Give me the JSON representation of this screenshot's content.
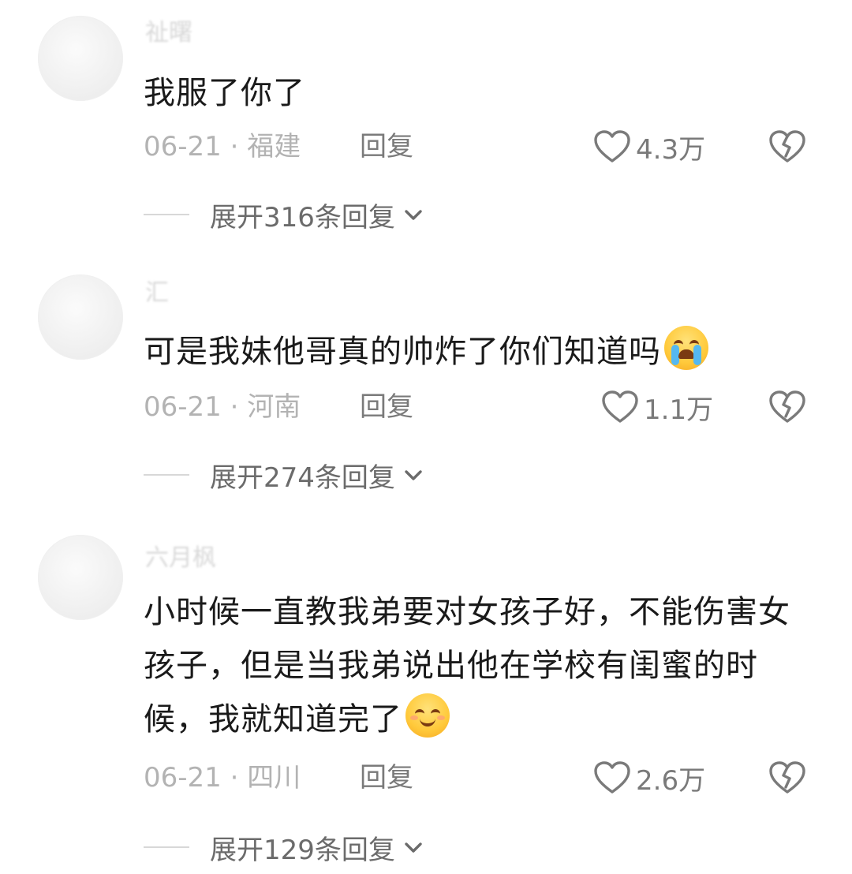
{
  "comments": [
    {
      "username": "祉曙",
      "text": "我服了你了",
      "emoji": "",
      "date": "06-21",
      "separator": "·",
      "location": "福建",
      "reply_label": "回复",
      "likes": "4.3万",
      "expand_label": "展开316条回复"
    },
    {
      "username": "汇",
      "text": "可是我妹他哥真的帅炸了你们知道吗",
      "emoji": "loudly-crying-face",
      "date": "06-21",
      "separator": "·",
      "location": "河南",
      "reply_label": "回复",
      "likes": "1.1万",
      "expand_label": "展开274条回复"
    },
    {
      "username": "六月枫",
      "text": "小时候一直教我弟要对女孩子好，不能伤害女孩子，但是当我弟说出他在学校有闺蜜的时候，我就知道完了",
      "emoji": "smiling-face-with-smiling-eyes",
      "date": "06-21",
      "separator": "·",
      "location": "四川",
      "reply_label": "回复",
      "likes": "2.6万",
      "expand_label": "展开129条回复"
    }
  ],
  "colors": {
    "text": "#1a1a1a",
    "meta": "#b3b3b3",
    "secondary": "#7a7a7a"
  }
}
